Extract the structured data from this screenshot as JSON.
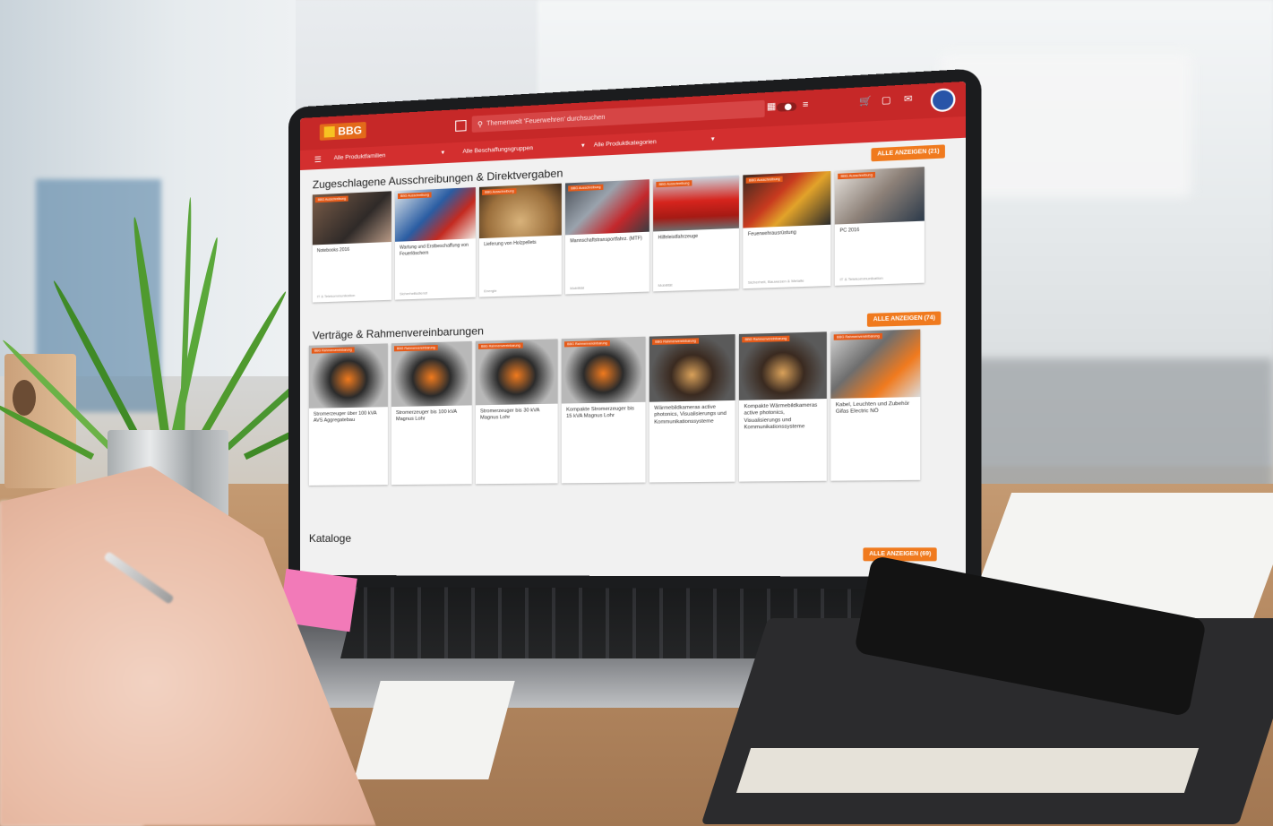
{
  "app": {
    "logo_text": "BBG",
    "search_placeholder": "Themenwelt 'Feuerwehren' durchsuchen"
  },
  "filters": [
    {
      "label": "Alle Produktfamilien"
    },
    {
      "label": "Alle Beschaffungsgruppen"
    },
    {
      "label": "Alle Produktkategorien"
    }
  ],
  "sections": {
    "tenders": {
      "title": "Zugeschlagene Ausschreibungen & Direktvergaben",
      "show_all": "ALLE ANZEIGEN (21)",
      "badge": "BBG Ausschreibung",
      "cards": [
        {
          "title": "Notebooks 2016",
          "category": "IT & Telekommunikation"
        },
        {
          "title": "Wartung und Erstbeschaffung von Feuerlöschern",
          "category": "Sicherheitsdienst"
        },
        {
          "title": "Lieferung von Holzpellets",
          "category": "Energie"
        },
        {
          "title": "Mannschaftstransportfahrz. (MTF)",
          "category": "Mobilität"
        },
        {
          "title": "Hilfeleistfahrzeuge",
          "category": "Mobilität"
        },
        {
          "title": "Feuerwehrausrüstung",
          "category": "Sicherheit, Bauwesen & Metalle"
        },
        {
          "title": "PC 2016",
          "category": "IT & Telekommunikation"
        }
      ]
    },
    "contracts": {
      "title": "Verträge & Rahmenvereinbarungen",
      "show_all": "ALLE ANZEIGEN (74)",
      "badge": "BBG Rahmenvereinbarung",
      "cards": [
        {
          "title": "Stromerzeuger über 100 kVA AVS Aggregatebau"
        },
        {
          "title": "Stromerzeuger bis 100 kVA Magnus Lohr"
        },
        {
          "title": "Stromerzeuger bis 30 kVA Magnus Lohr"
        },
        {
          "title": "Kompakte Stromerzeuger bis 15 kVA Magnus Lohr"
        },
        {
          "title": "Wärmebildkameras active photonics, Visualisierungs und Kommunikationssysteme"
        },
        {
          "title": "Kompakte Wärmebildkameras active photonics, Visualisierungs und Kommunikationssysteme"
        },
        {
          "title": "Kabel, Leuchten und Zubehör Gifas Electric NÖ"
        }
      ]
    },
    "catalogs": {
      "title": "Kataloge",
      "show_all": "ALLE ANZEIGEN (69)"
    }
  },
  "colors": {
    "brand_red": "#c62828",
    "accent_orange": "#f07a1e"
  }
}
